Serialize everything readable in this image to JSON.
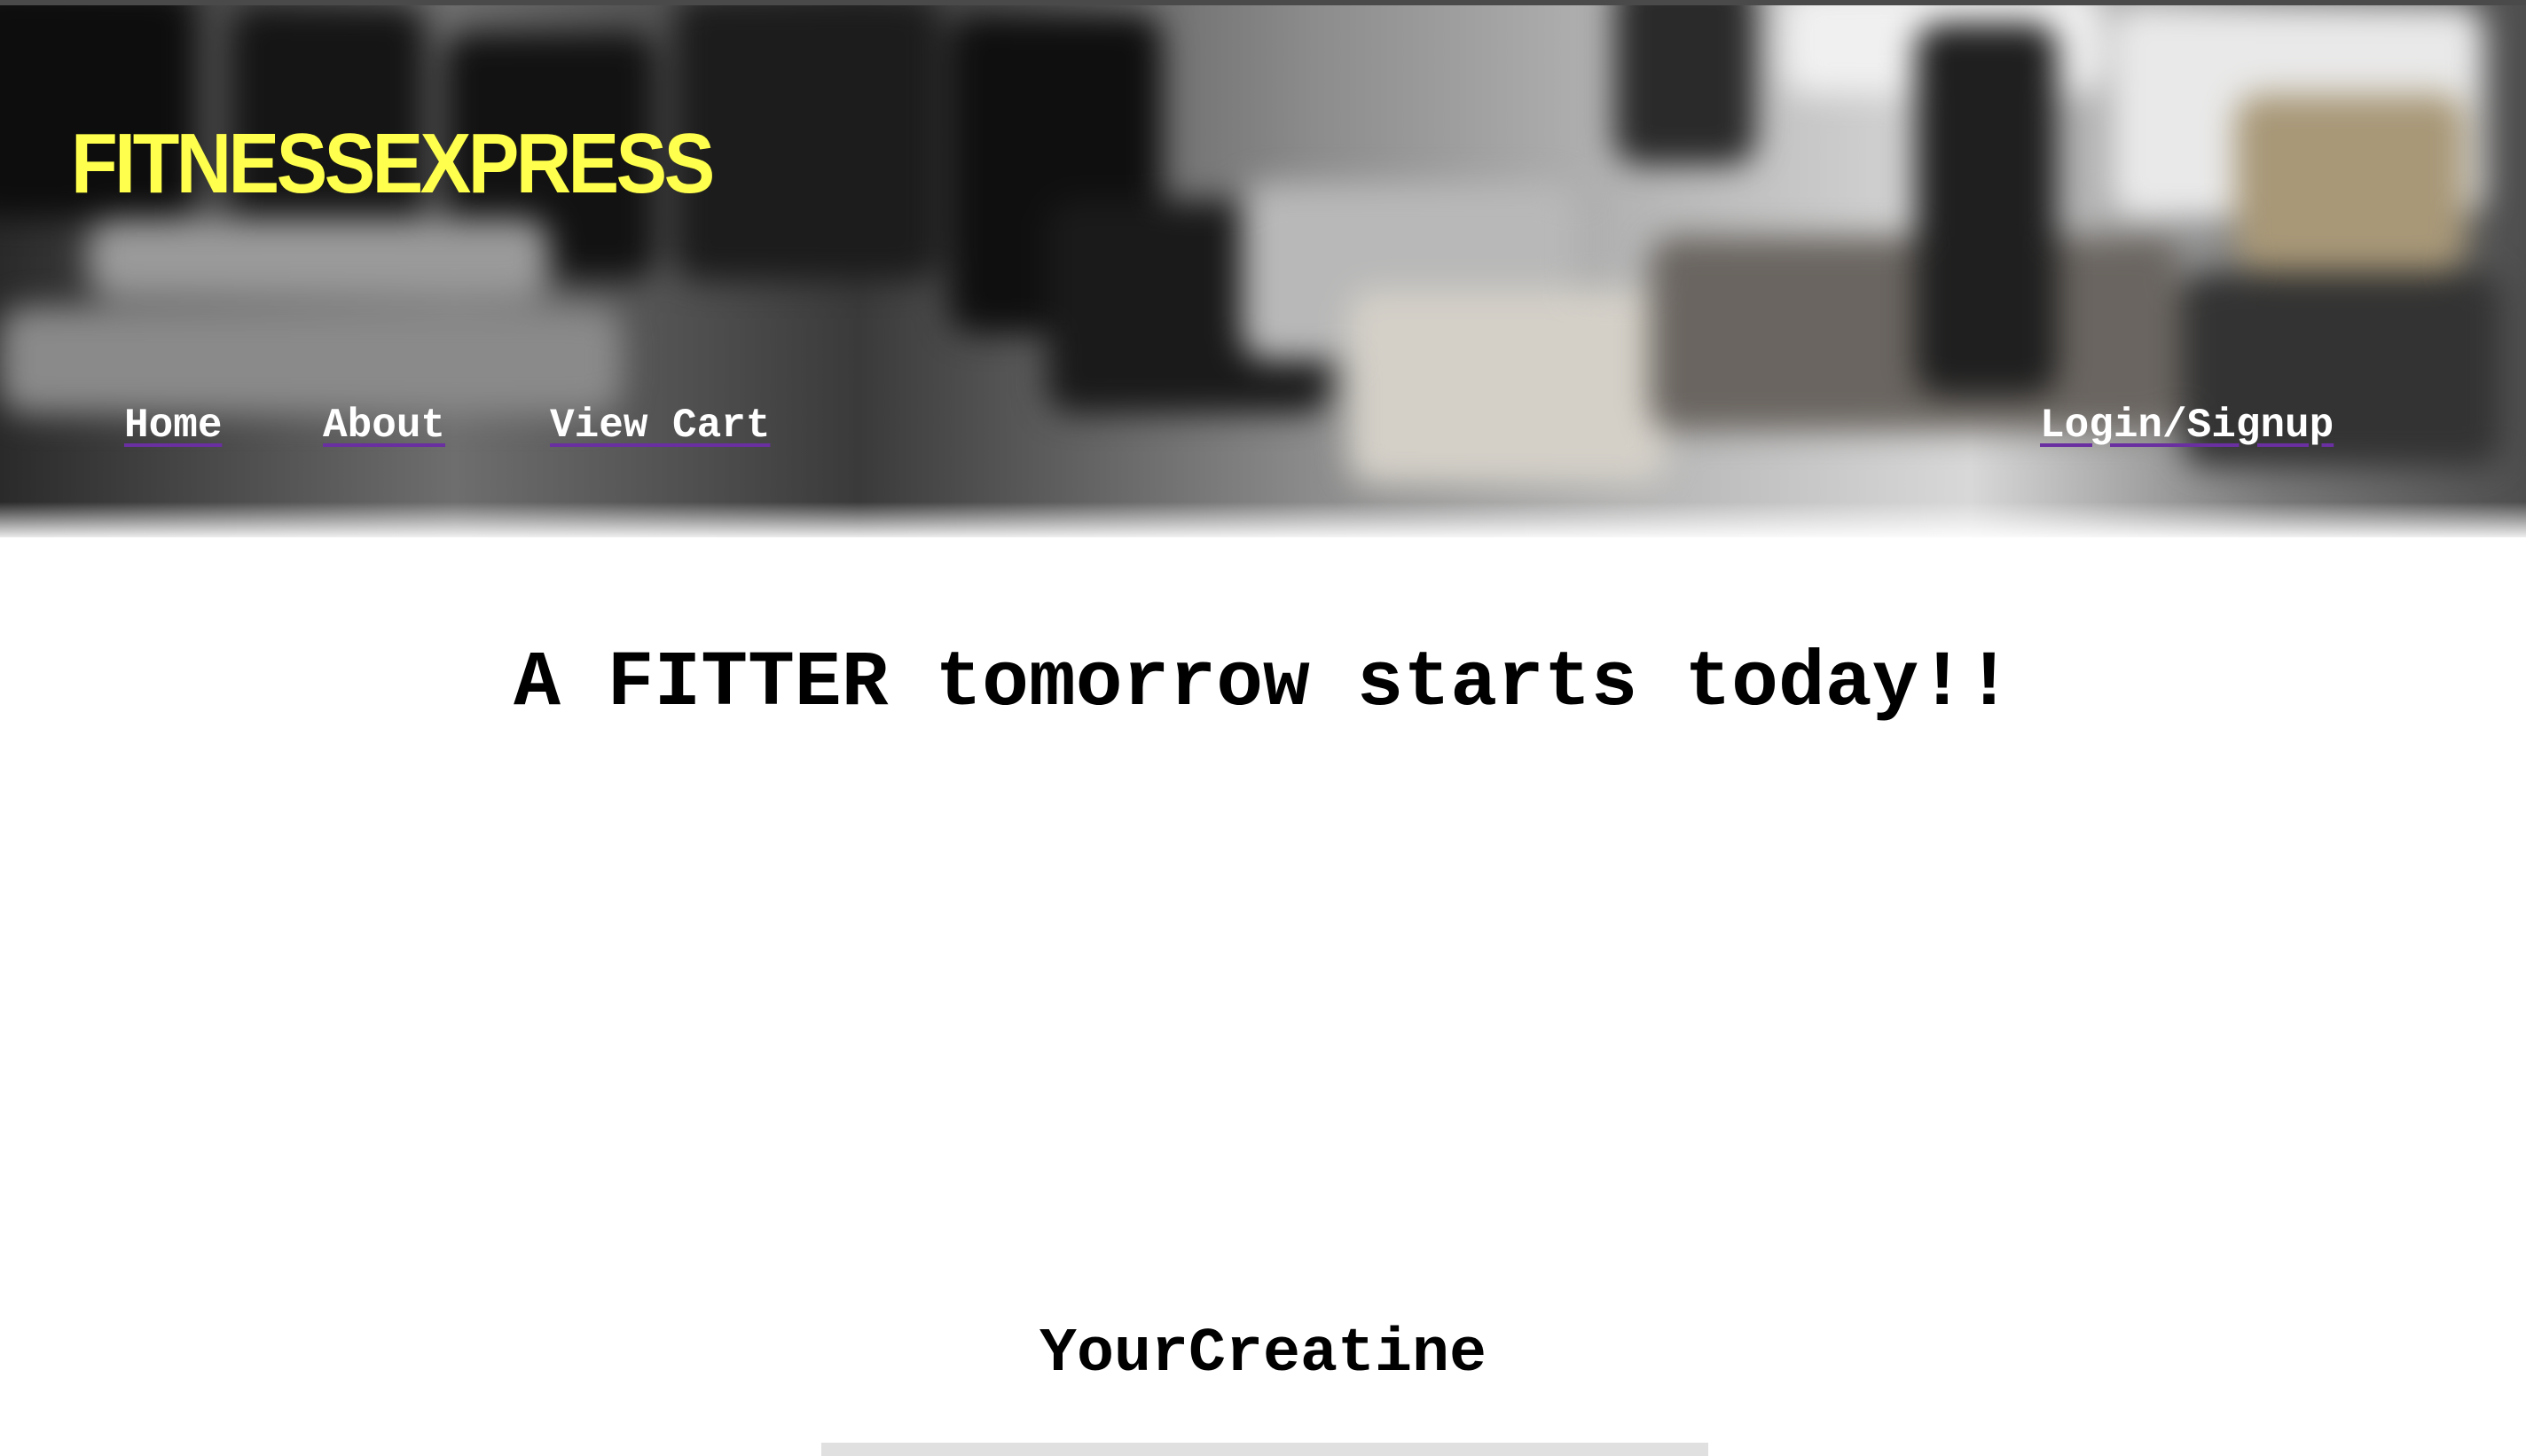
{
  "site": {
    "brand": "FITNESSEXPRESS",
    "brand_color": "#ffff4d"
  },
  "nav": {
    "items": [
      {
        "label": "Home"
      },
      {
        "label": "About"
      },
      {
        "label": "View Cart"
      }
    ],
    "login_label": "Login/Signup",
    "underline_color": "#6a2fa0"
  },
  "hero": {
    "image": "blurred gym dumbbell rack"
  },
  "main": {
    "headline": "A FITTER tomorrow starts today!!"
  },
  "product": {
    "title": "YourCreatine"
  }
}
